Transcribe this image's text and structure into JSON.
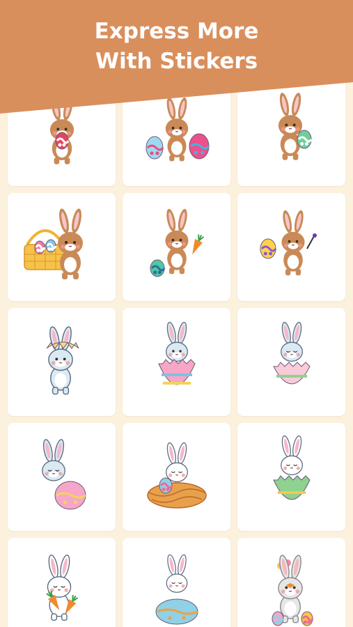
{
  "header": {
    "title_line1": "Express More",
    "title_line2": "With Stickers",
    "background_color": "#d98f5c"
  },
  "stickers": [
    {
      "icon": "brown-bunny-eating-egg-icon"
    },
    {
      "icon": "brown-bunny-holding-two-eggs-icon"
    },
    {
      "icon": "brown-bunny-running-with-egg-icon"
    },
    {
      "icon": "brown-bunny-with-egg-basket-icon"
    },
    {
      "icon": "brown-bunny-with-carrot-icon"
    },
    {
      "icon": "brown-bunny-with-egg-and-brush-icon"
    },
    {
      "icon": "blue-bunny-in-eggshell-hat-icon"
    },
    {
      "icon": "blue-bunny-hatching-from-egg-icon"
    },
    {
      "icon": "blue-bunny-in-cracked-egg-icon"
    },
    {
      "icon": "blue-bunny-leaning-on-egg-icon"
    },
    {
      "icon": "white-bunny-sleeping-in-nest-icon"
    },
    {
      "icon": "white-bunny-in-green-egg-icon"
    },
    {
      "icon": "white-bunny-holding-carrots-icon"
    },
    {
      "icon": "white-bunny-sleeping-on-egg-icon"
    },
    {
      "icon": "grey-bunny-with-flowers-and-eggs-icon"
    }
  ]
}
